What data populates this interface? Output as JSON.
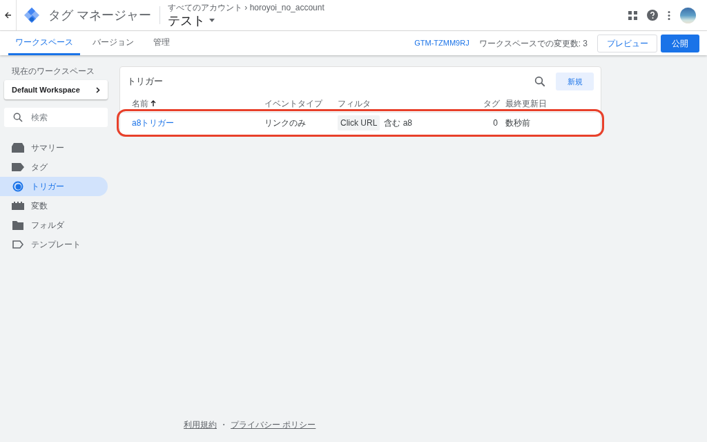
{
  "header": {
    "app_title": "タグ マネージャー",
    "breadcrumb": "すべてのアカウント › horoyoi_no_account",
    "container": "テスト"
  },
  "tabs": [
    {
      "label": "ワークスペース",
      "selected": true
    },
    {
      "label": "バージョン",
      "selected": false
    },
    {
      "label": "管理",
      "selected": false
    }
  ],
  "toolbar": {
    "container_id": "GTM-TZMM9RJ",
    "changes": "ワークスペースでの変更数: 3",
    "preview": "プレビュー",
    "publish": "公開"
  },
  "sidebar": {
    "workspace_label": "現在のワークスペース",
    "workspace": "Default Workspace",
    "search_placeholder": "検索",
    "items": [
      {
        "kind": "summary",
        "label": "サマリー",
        "selected": false
      },
      {
        "kind": "tag",
        "label": "タグ",
        "selected": false
      },
      {
        "kind": "trigger",
        "label": "トリガー",
        "selected": true
      },
      {
        "kind": "variable",
        "label": "変数",
        "selected": false
      },
      {
        "kind": "folder",
        "label": "フォルダ",
        "selected": false
      },
      {
        "kind": "template",
        "label": "テンプレート",
        "selected": false
      }
    ]
  },
  "panel": {
    "title": "トリガー",
    "new_button": "新規",
    "columns": [
      "名前",
      "イベントタイプ",
      "フィルタ",
      "タグ",
      "最終更新日"
    ],
    "rows": [
      {
        "name": "a8トリガー",
        "event_type": "リンクのみ",
        "filter_variable": "Click URL",
        "filter_condition": "含む a8",
        "tags": "0",
        "updated": "数秒前",
        "highlighted": true
      }
    ]
  },
  "footer": {
    "terms": "利用規約",
    "separator": "・",
    "privacy": "プライバシー ポリシー"
  }
}
